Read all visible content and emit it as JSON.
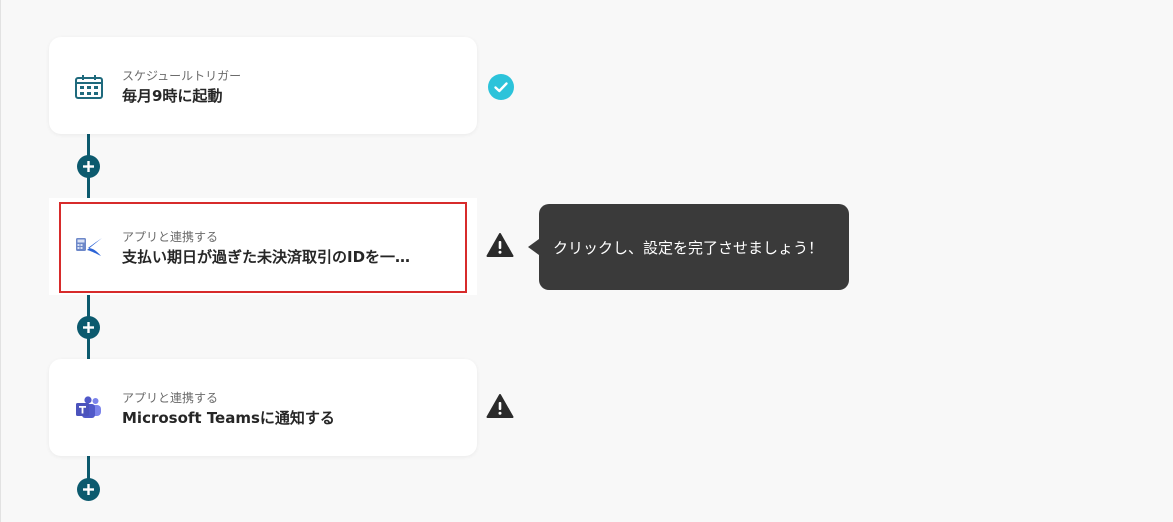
{
  "flow": {
    "steps": [
      {
        "subtitle": "スケジュールトリガー",
        "title": "毎月9時に起動",
        "icon": "calendar-schedule-icon",
        "status": "complete"
      },
      {
        "subtitle": "アプリと連携する",
        "title": "支払い期日が過ぎた未決済取引のIDを一…",
        "icon": "freee-accounting-icon",
        "status": "warning",
        "selected": true
      },
      {
        "subtitle": "アプリと連携する",
        "title": "Microsoft Teamsに通知する",
        "icon": "microsoft-teams-icon",
        "status": "warning"
      }
    ],
    "add_button_label": "+"
  },
  "tooltip": {
    "text": "クリックし、設定を完了させましょう！"
  },
  "colors": {
    "connector": "#0c5a6e",
    "check": "#2cc3da",
    "highlight_border": "#d72b2b",
    "tooltip_bg": "#3a3a3a",
    "warning": "#2b2b2b"
  }
}
